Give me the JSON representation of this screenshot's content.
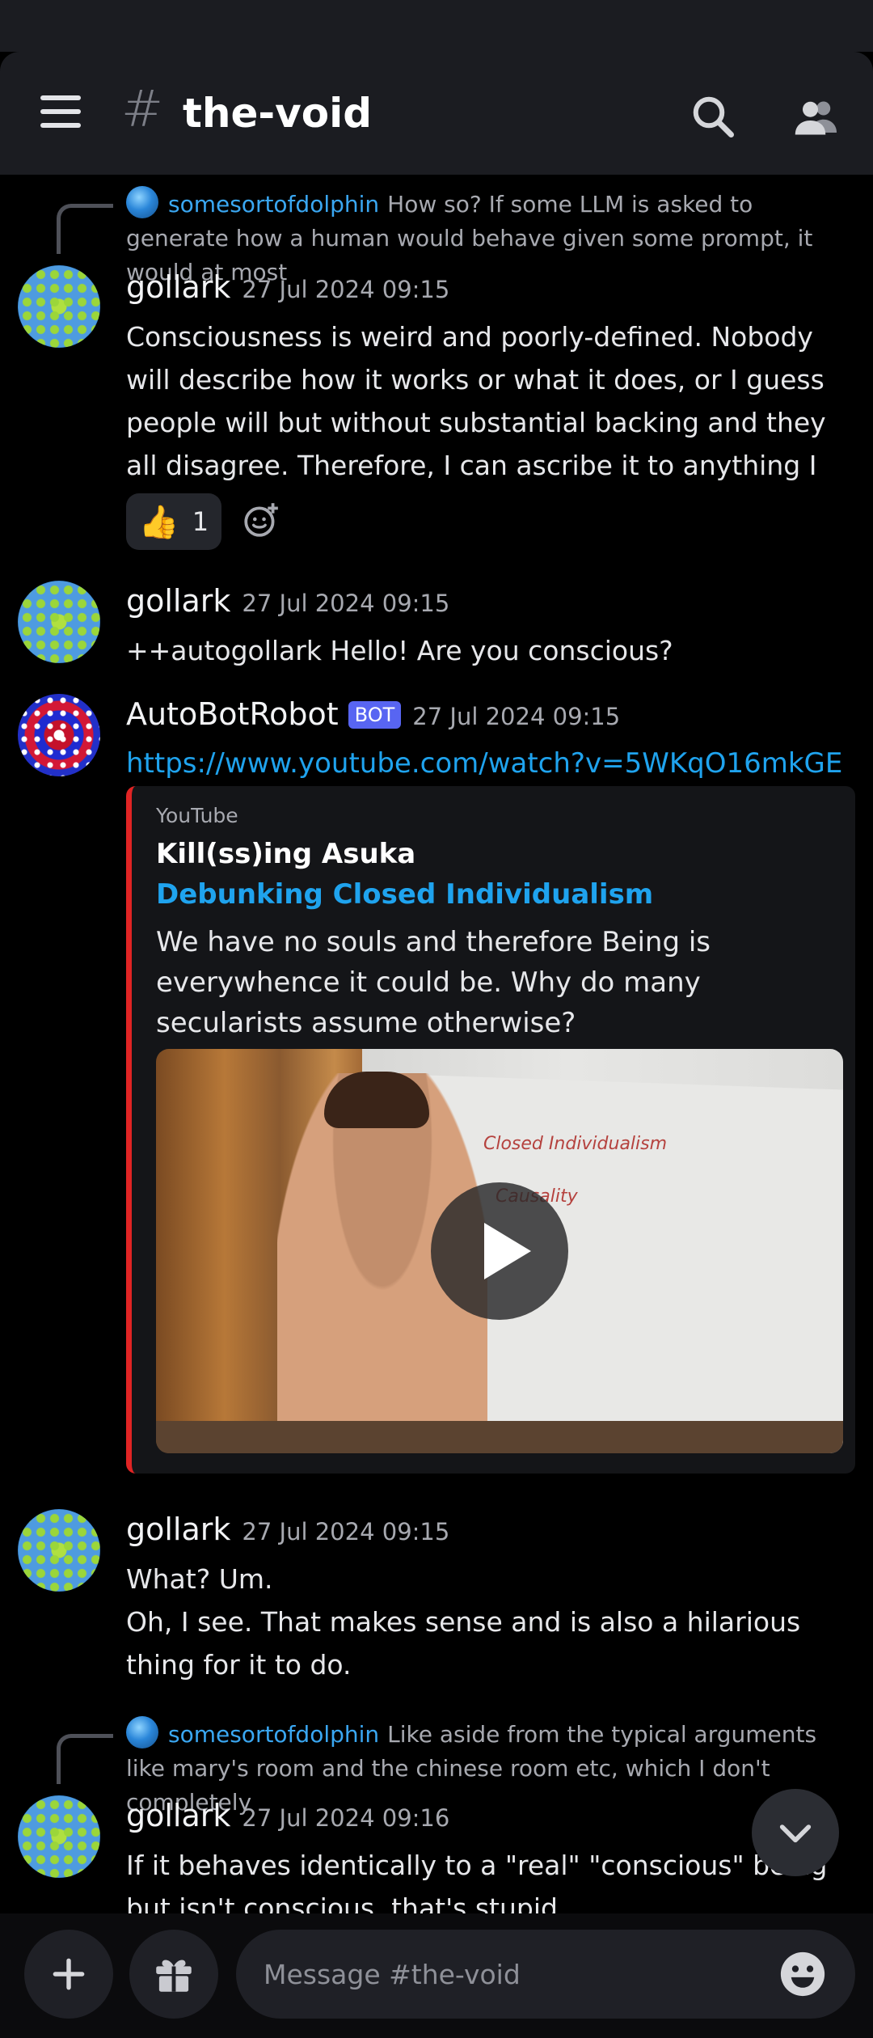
{
  "header": {
    "hash": "#",
    "channel": "the-void"
  },
  "messages": {
    "reply1": {
      "name": "somesortofdolphin",
      "text": "How so? If some LLM is asked to generate how a human would behave given some prompt, it would at most"
    },
    "msg1": {
      "author": "gollark",
      "timestamp": "27 Jul 2024 09:15",
      "body": "Consciousness is weird and poorly-defined. Nobody will describe how it works or what it does, or I guess people will but without substantial backing and they all disagree. Therefore, I can ascribe it to anything I want.",
      "reaction_emoji": "👍",
      "reaction_count": "1"
    },
    "msg2": {
      "author": "gollark",
      "timestamp": "27 Jul 2024 09:15",
      "body": "++autogollark Hello! Are you conscious?"
    },
    "msg3": {
      "author": "AutoBotRobot",
      "bot_tag": "BOT",
      "timestamp": "27 Jul 2024 09:15",
      "link": "https://www.youtube.com/watch?v=5WKqO16mkGE",
      "embed": {
        "provider": "YouTube",
        "author": "Kill(ss)ing Asuka",
        "title": "Debunking Closed Individualism",
        "description": "We have no souls and therefore Being is everywhence it could be. Why do many secularists assume otherwise?",
        "thumb_text_1": "Closed Individualism",
        "thumb_text_2": "Causality"
      }
    },
    "msg4": {
      "author": "gollark",
      "timestamp": "27 Jul 2024 09:15",
      "line1": "What? Um.",
      "line2": "Oh, I see. That makes sense and is also a hilarious thing for it to do."
    },
    "reply2": {
      "name": "somesortofdolphin",
      "text": "Like aside from the typical arguments like mary's room and the chinese room etc, which I don't completely"
    },
    "msg5": {
      "author": "gollark",
      "timestamp": "27 Jul 2024 09:16",
      "body": "If it behaves identically to a \"real\" \"conscious\" being but isn't conscious, that's stupid."
    }
  },
  "composer": {
    "placeholder": "Message #the-void"
  }
}
